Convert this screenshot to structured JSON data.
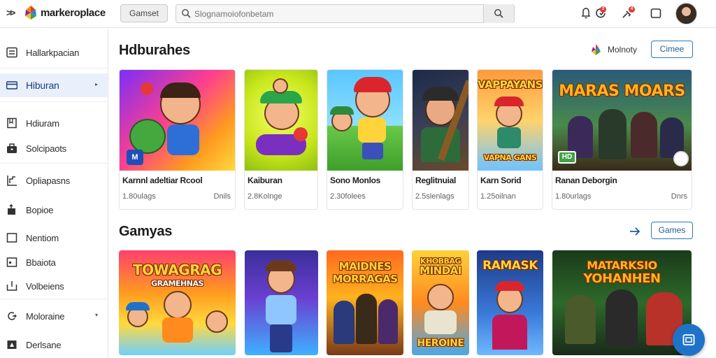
{
  "header": {
    "logo_text": "markeroplace",
    "nav_button": "Gamset",
    "search_placeholder": "Slognamoiofonbetam",
    "badge_1": "2",
    "badge_2": "4"
  },
  "sidebar": {
    "items": [
      {
        "label": "Hallarkpacian",
        "icon": "list-icon"
      },
      {
        "label": "Hiburan",
        "icon": "card-icon",
        "active": true,
        "arrow": "▸"
      },
      {
        "label": "Hdiuram",
        "icon": "bookmark-icon"
      },
      {
        "label": "Solcipaots",
        "icon": "briefcase-icon"
      },
      {
        "label": "Opliapasns",
        "icon": "chart-icon"
      },
      {
        "label": "Bopioe",
        "icon": "share-icon"
      },
      {
        "label": "Nentiom",
        "icon": "square-icon"
      },
      {
        "label": "Bbaiota",
        "icon": "box-icon"
      },
      {
        "label": "Volbeiens",
        "icon": "tray-icon"
      },
      {
        "label": "Moloraine",
        "icon": "swap-icon",
        "arrow": "▾"
      },
      {
        "label": "Derlsane",
        "icon": "flag-icon"
      }
    ]
  },
  "sections": [
    {
      "title": "Hdburahes",
      "link_text": "Molnoty",
      "button": "Cimee"
    },
    {
      "title": "Gamyas",
      "button": "Games"
    }
  ],
  "cards_row1": [
    {
      "title": "Karnnl adeltiar Rcool",
      "meta": "1.80ulags",
      "tag": "Dnils",
      "badge": "M"
    },
    {
      "title": "Kaiburan",
      "meta": "2.8Kolnge",
      "tag": ""
    },
    {
      "title": "Sono Monlos",
      "meta": "2.30folees",
      "tag": ""
    },
    {
      "title": "Reglitnuial",
      "meta": "2.5slenlags",
      "tag": ""
    },
    {
      "title": "Karn Sorid",
      "meta": "1.25oilnan",
      "tag": "",
      "thumb_text": "VAPPAYANS",
      "thumb_sub": "VAPNA GANS"
    },
    {
      "title": "Ranan Deborgin",
      "meta": "1.80urlags",
      "tag": "Dnrs",
      "thumb_text": "MARAS MOARS",
      "badge": "HD"
    }
  ],
  "cards_row2": [
    {
      "thumb_text": "TOWAGRAG",
      "thumb_sub": "GRAMEHNAS"
    },
    {
      "thumb_text": ""
    },
    {
      "thumb_text": "MAIDNES",
      "thumb_sub": "MORRAGAS"
    },
    {
      "thumb_text": "KHOBBAG",
      "thumb_sub": "MINDAI",
      "thumb_bottom": "HEROINE"
    },
    {
      "thumb_text": "RAMASK"
    },
    {
      "thumb_text": "MATARKSIO",
      "thumb_sub": "YOHANHEN"
    }
  ],
  "colors": {
    "accent": "#1e73c9",
    "button_border": "#2a7ab8",
    "sidebar_active": "#eaf0fb",
    "badge": "#e53935"
  }
}
